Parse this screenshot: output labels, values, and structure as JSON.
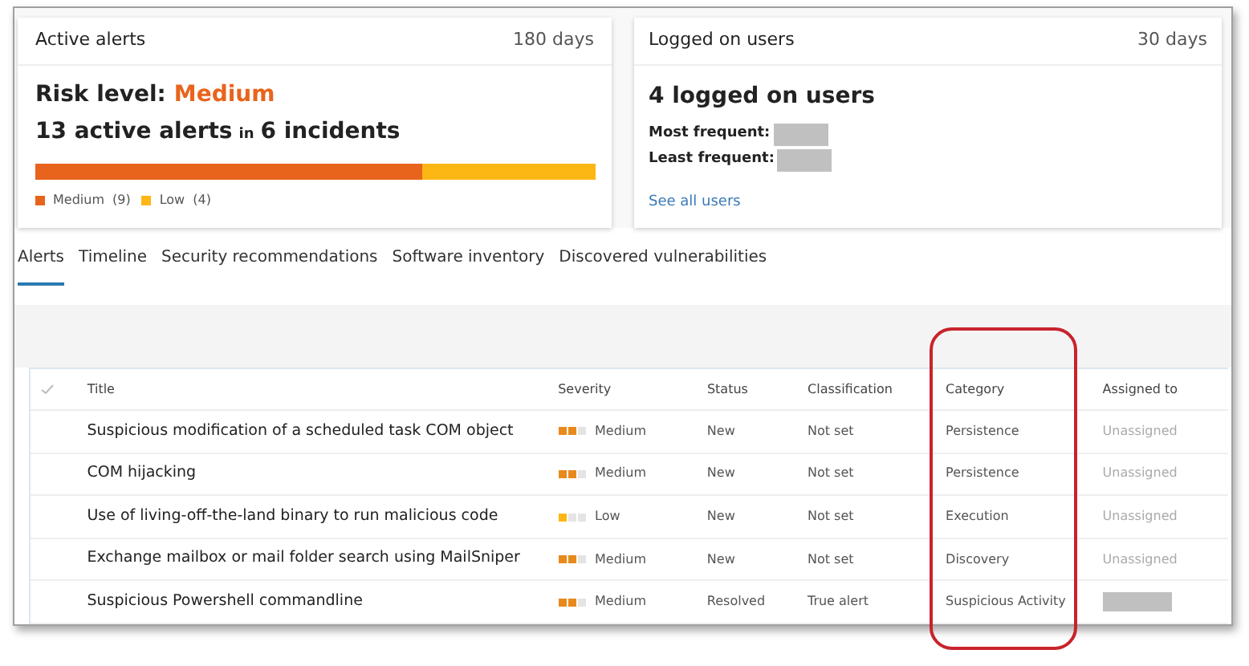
{
  "alerts_card": {
    "title": "Active alerts",
    "period": "180 days",
    "risk_label": "Risk level:",
    "risk_value": "Medium",
    "summary": [
      "13 active alerts",
      "in",
      "6 incidents"
    ],
    "bar": {
      "level": 0.69
    },
    "legend": [
      {
        "label": "Medium",
        "count": "(9)",
        "color": "#e8641c"
      },
      {
        "label": "Low",
        "count": "(4)",
        "color": "#fcb714"
      }
    ]
  },
  "users_card": {
    "title": "Logged on users",
    "period": "30 days",
    "heading": "4 logged on users",
    "fields": [
      {
        "label": "Most frequent:",
        "redacted": true
      },
      {
        "label": "Least frequent:",
        "redacted": true
      }
    ],
    "link": "See all users"
  },
  "tabs": [
    {
      "label": "Alerts",
      "selected": true
    },
    {
      "label": "Timeline",
      "selected": false
    },
    {
      "label": "Security recommendations",
      "selected": false
    },
    {
      "label": "Software inventory",
      "selected": false
    },
    {
      "label": "Discovered vulnerabilities",
      "selected": false
    }
  ],
  "table": {
    "columns": [
      "Title",
      "Severity",
      "Status",
      "Classification",
      "Category",
      "Assigned to"
    ],
    "rows": [
      {
        "title": "Suspicious modification of a scheduled task COM object",
        "severity": {
          "kind": "medium",
          "label": "Medium"
        },
        "status": "New",
        "classification": "Not set",
        "category": "Persistence",
        "assigned": {
          "redacted": false,
          "text": "Unassigned"
        }
      },
      {
        "title": "COM hijacking",
        "severity": {
          "kind": "medium",
          "label": "Medium"
        },
        "status": "New",
        "classification": "Not set",
        "category": "Persistence",
        "assigned": {
          "redacted": false,
          "text": "Unassigned"
        }
      },
      {
        "title": "Use of living-off-the-land binary to run malicious code",
        "severity": {
          "kind": "low",
          "label": "Low"
        },
        "status": "New",
        "classification": "Not set",
        "category": "Execution",
        "assigned": {
          "redacted": false,
          "text": "Unassigned"
        }
      },
      {
        "title": "Exchange mailbox or mail folder search using MailSniper",
        "severity": {
          "kind": "medium",
          "label": "Medium"
        },
        "status": "New",
        "classification": "Not set",
        "category": "Discovery",
        "assigned": {
          "redacted": false,
          "text": "Unassigned"
        }
      },
      {
        "title": "Suspicious Powershell commandline",
        "severity": {
          "kind": "medium",
          "label": "Medium"
        },
        "status": "Resolved",
        "classification": "True alert",
        "category": "Suspicious Activity",
        "assigned": {
          "redacted": true
        }
      }
    ]
  }
}
